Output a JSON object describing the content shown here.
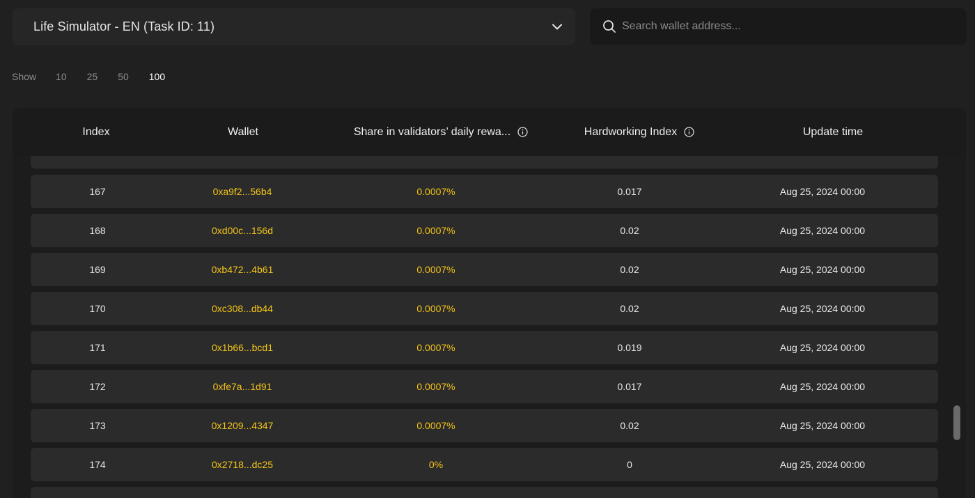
{
  "task_select": {
    "label": "Life Simulator - EN (Task ID: 11)"
  },
  "search": {
    "placeholder": "Search wallet address..."
  },
  "show": {
    "label": "Show",
    "options": [
      "10",
      "25",
      "50",
      "100"
    ],
    "selected": "100"
  },
  "table": {
    "headers": {
      "index": "Index",
      "wallet": "Wallet",
      "share": "Share in validators’ daily rewa...",
      "hardworking": "Hardworking Index",
      "update_time": "Update time"
    },
    "rows": [
      {
        "index": "167",
        "wallet": "0xa9f2...56b4",
        "share": "0.0007%",
        "hardworking": "0.017",
        "update_time": "Aug 25, 2024 00:00"
      },
      {
        "index": "168",
        "wallet": "0xd00c...156d",
        "share": "0.0007%",
        "hardworking": "0.02",
        "update_time": "Aug 25, 2024 00:00"
      },
      {
        "index": "169",
        "wallet": "0xb472...4b61",
        "share": "0.0007%",
        "hardworking": "0.02",
        "update_time": "Aug 25, 2024 00:00"
      },
      {
        "index": "170",
        "wallet": "0xc308...db44",
        "share": "0.0007%",
        "hardworking": "0.02",
        "update_time": "Aug 25, 2024 00:00"
      },
      {
        "index": "171",
        "wallet": "0x1b66...bcd1",
        "share": "0.0007%",
        "hardworking": "0.019",
        "update_time": "Aug 25, 2024 00:00"
      },
      {
        "index": "172",
        "wallet": "0xfe7a...1d91",
        "share": "0.0007%",
        "hardworking": "0.017",
        "update_time": "Aug 25, 2024 00:00"
      },
      {
        "index": "173",
        "wallet": "0x1209...4347",
        "share": "0.0007%",
        "hardworking": "0.02",
        "update_time": "Aug 25, 2024 00:00"
      },
      {
        "index": "174",
        "wallet": "0x2718...dc25",
        "share": "0%",
        "hardworking": "0",
        "update_time": "Aug 25, 2024 00:00"
      }
    ]
  },
  "colors": {
    "accent": "#f5c518",
    "background": "#202020",
    "row": "#2b2b2b"
  },
  "icons": {
    "dropdown": "chevron-down-icon",
    "search": "search-icon",
    "info": "info-icon"
  }
}
